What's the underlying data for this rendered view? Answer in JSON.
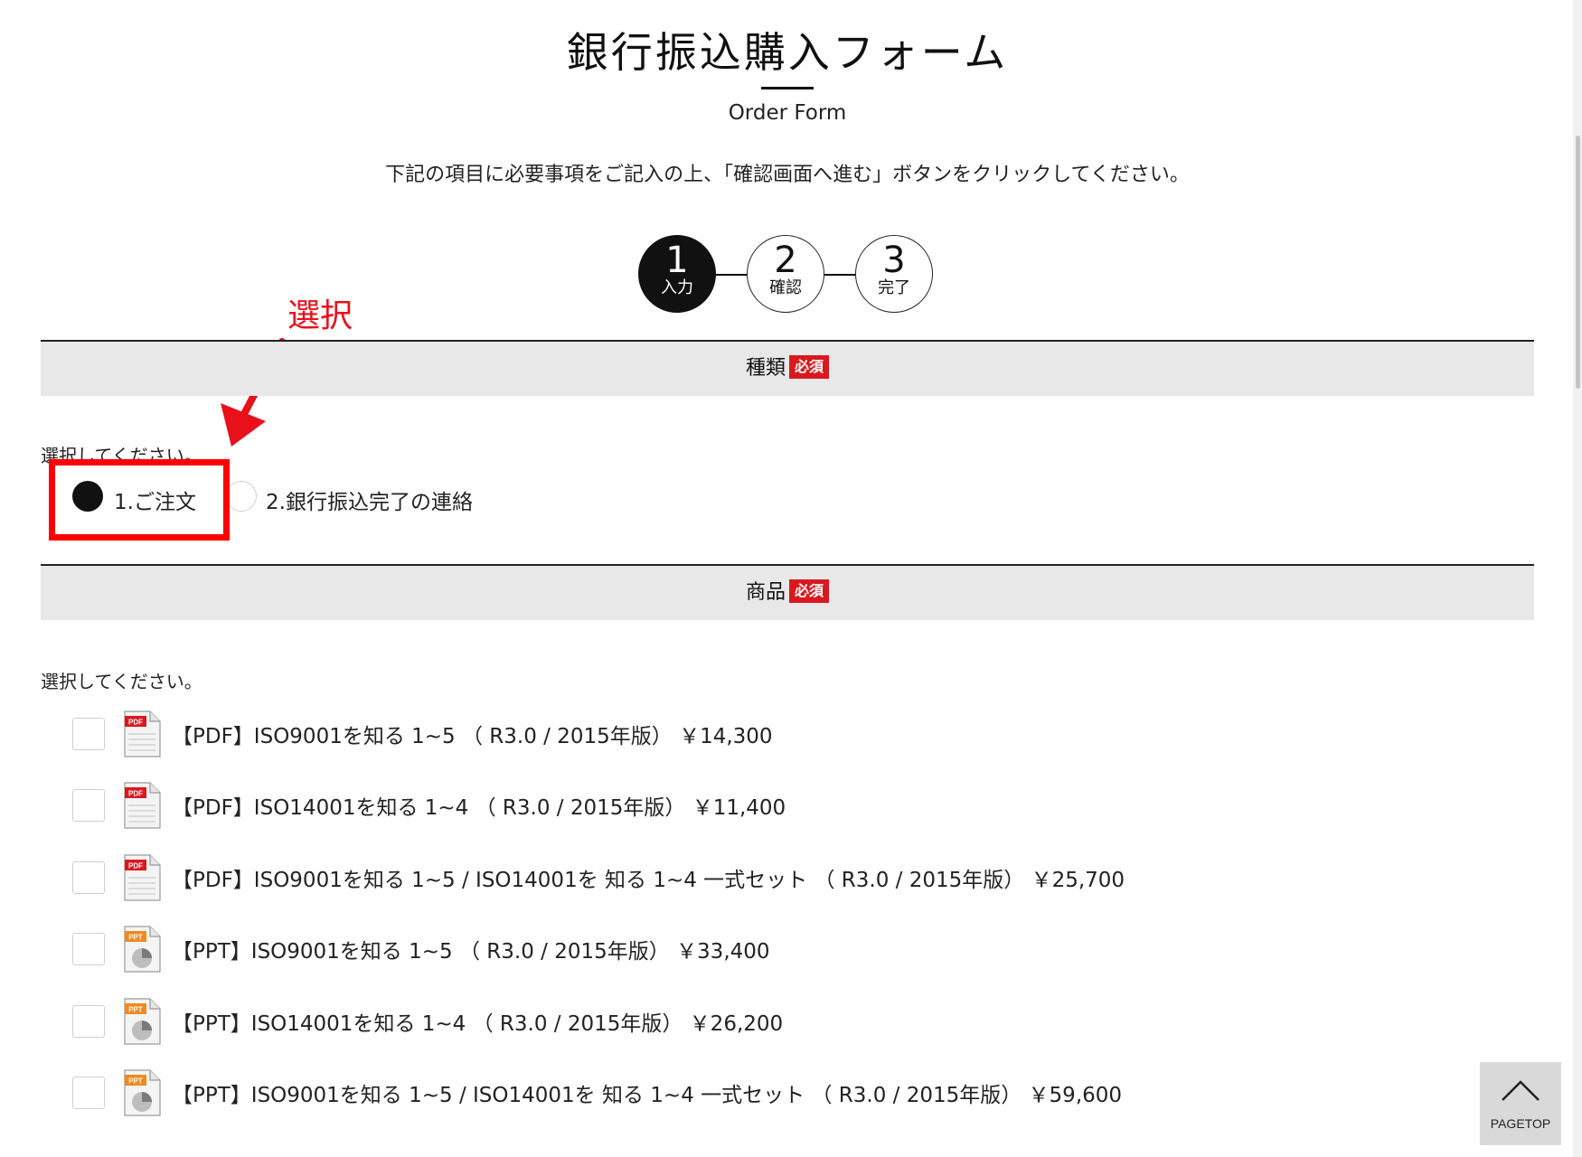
{
  "header": {
    "title": "銀行振込購入フォーム",
    "subtitle": "Order Form",
    "instruction": "下記の項目に必要事項をご記入の上、「確認画面へ進む」ボタンをクリックしてください。"
  },
  "steps": [
    {
      "number": "1",
      "label": "入力",
      "state": "active"
    },
    {
      "number": "2",
      "label": "確認",
      "state": "inactive"
    },
    {
      "number": "3",
      "label": "完了",
      "state": "inactive"
    }
  ],
  "annotation": {
    "text": "選択",
    "color": "#e8101a"
  },
  "sections": {
    "type": {
      "header": "種類",
      "badge": "必須",
      "prompt": "選択してください。",
      "options": [
        {
          "label": "1.ご注文",
          "checked": true
        },
        {
          "label": "2.銀行振込完了の連絡",
          "checked": false
        }
      ]
    },
    "product": {
      "header": "商品",
      "badge": "必須",
      "prompt": "選択してください。",
      "items": [
        {
          "icon": "pdf-file-icon",
          "badge": "PDF",
          "label": "【PDF】ISO9001を知る 1~5 （ R3.0 / 2015年版） ￥14,300",
          "checked": false
        },
        {
          "icon": "pdf-file-icon",
          "badge": "PDF",
          "label": "【PDF】ISO14001を知る 1~4 （ R3.0 / 2015年版） ￥11,400",
          "checked": false
        },
        {
          "icon": "pdf-file-icon",
          "badge": "PDF",
          "label": "【PDF】ISO9001を知る 1~5 / ISO14001を 知る 1~4 一式セット （ R3.0 / 2015年版） ￥25,700",
          "checked": false
        },
        {
          "icon": "ppt-file-icon",
          "badge": "PPT",
          "label": "【PPT】ISO9001を知る 1~5 （ R3.0 / 2015年版） ￥33,400",
          "checked": false
        },
        {
          "icon": "ppt-file-icon",
          "badge": "PPT",
          "label": "【PPT】ISO14001を知る 1~4 （ R3.0 / 2015年版） ￥26,200",
          "checked": false
        },
        {
          "icon": "ppt-file-icon",
          "badge": "PPT",
          "label": "【PPT】ISO9001を知る 1~5 / ISO14001を 知る 1~4 一式セット （ R3.0 / 2015年版） ￥59,600",
          "checked": false
        }
      ]
    }
  },
  "pagetop": {
    "label": "PAGETOP"
  },
  "colors": {
    "required_badge": "#d9191f",
    "highlight": "#ff0000",
    "step_active": "#111111",
    "pdf_badge": "#d9191f",
    "ppt_badge": "#f08a1c"
  }
}
